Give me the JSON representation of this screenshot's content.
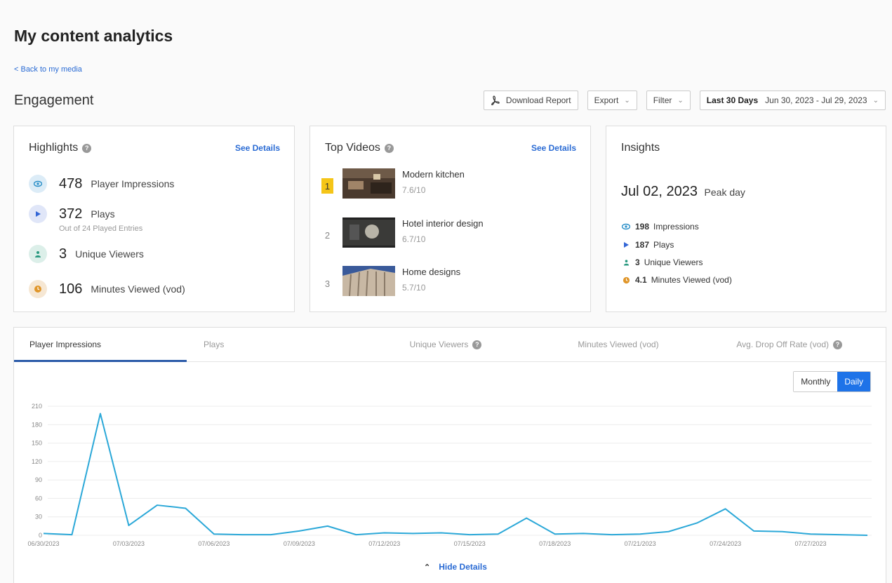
{
  "page": {
    "title": "My content analytics",
    "back_link": "< Back to my media",
    "section": "Engagement"
  },
  "toolbar": {
    "download": "Download Report",
    "export": "Export",
    "filter": "Filter",
    "range_label": "Last 30 Days",
    "range_value": "Jun 30, 2023 - Jul 29, 2023"
  },
  "highlights": {
    "title": "Highlights",
    "see_details": "See Details",
    "items": [
      {
        "value": "478",
        "label": "Player Impressions"
      },
      {
        "value": "372",
        "label": "Plays",
        "sub": "Out of 24 Played Entries"
      },
      {
        "value": "3",
        "label": "Unique Viewers"
      },
      {
        "value": "106",
        "label": "Minutes Viewed (vod)"
      }
    ]
  },
  "top_videos": {
    "title": "Top Videos",
    "see_details": "See Details",
    "items": [
      {
        "rank": "1",
        "name": "Modern kitchen",
        "score": "7.6/10"
      },
      {
        "rank": "2",
        "name": "Hotel interior design",
        "score": "6.7/10"
      },
      {
        "rank": "3",
        "name": "Home designs",
        "score": "5.7/10"
      }
    ]
  },
  "insights": {
    "title": "Insights",
    "peak_date": "Jul 02, 2023",
    "peak_label": "Peak day",
    "items": [
      {
        "value": "198",
        "label": "Impressions"
      },
      {
        "value": "187",
        "label": "Plays"
      },
      {
        "value": "3",
        "label": "Unique Viewers"
      },
      {
        "value": "4.1",
        "label": "Minutes Viewed (vod)"
      }
    ]
  },
  "tabs": [
    "Player Impressions",
    "Plays",
    "Unique Viewers",
    "Minutes Viewed (vod)",
    "Avg. Drop Off Rate (vod)"
  ],
  "toggle": {
    "monthly": "Monthly",
    "daily": "Daily"
  },
  "hide_details": "Hide Details",
  "colors": {
    "accent": "#1e73e8",
    "line": "#2ba8d8",
    "tab_underline": "#2a5aa8",
    "rank_gold": "#f5c518"
  },
  "chart_data": {
    "type": "line",
    "yticks": [
      0,
      30,
      60,
      90,
      120,
      150,
      180,
      210
    ],
    "ylim": [
      0,
      210
    ],
    "xticks": [
      "06/30/2023",
      "07/03/2023",
      "07/06/2023",
      "07/09/2023",
      "07/12/2023",
      "07/15/2023",
      "07/18/2023",
      "07/21/2023",
      "07/24/2023",
      "07/27/2023"
    ],
    "x": [
      "06/30/2023",
      "07/01/2023",
      "07/02/2023",
      "07/03/2023",
      "07/04/2023",
      "07/05/2023",
      "07/06/2023",
      "07/07/2023",
      "07/08/2023",
      "07/09/2023",
      "07/10/2023",
      "07/11/2023",
      "07/12/2023",
      "07/13/2023",
      "07/14/2023",
      "07/15/2023",
      "07/16/2023",
      "07/17/2023",
      "07/18/2023",
      "07/19/2023",
      "07/20/2023",
      "07/21/2023",
      "07/22/2023",
      "07/23/2023",
      "07/24/2023",
      "07/25/2023",
      "07/26/2023",
      "07/27/2023",
      "07/28/2023",
      "07/29/2023"
    ],
    "series": [
      {
        "values": [
          3,
          1,
          198,
          16,
          49,
          44,
          2,
          1,
          1,
          7,
          15,
          1,
          4,
          3,
          4,
          1,
          2,
          28,
          2,
          3,
          1,
          2,
          6,
          20,
          43,
          7,
          6,
          2,
          1,
          0
        ]
      }
    ],
    "grid": true
  }
}
